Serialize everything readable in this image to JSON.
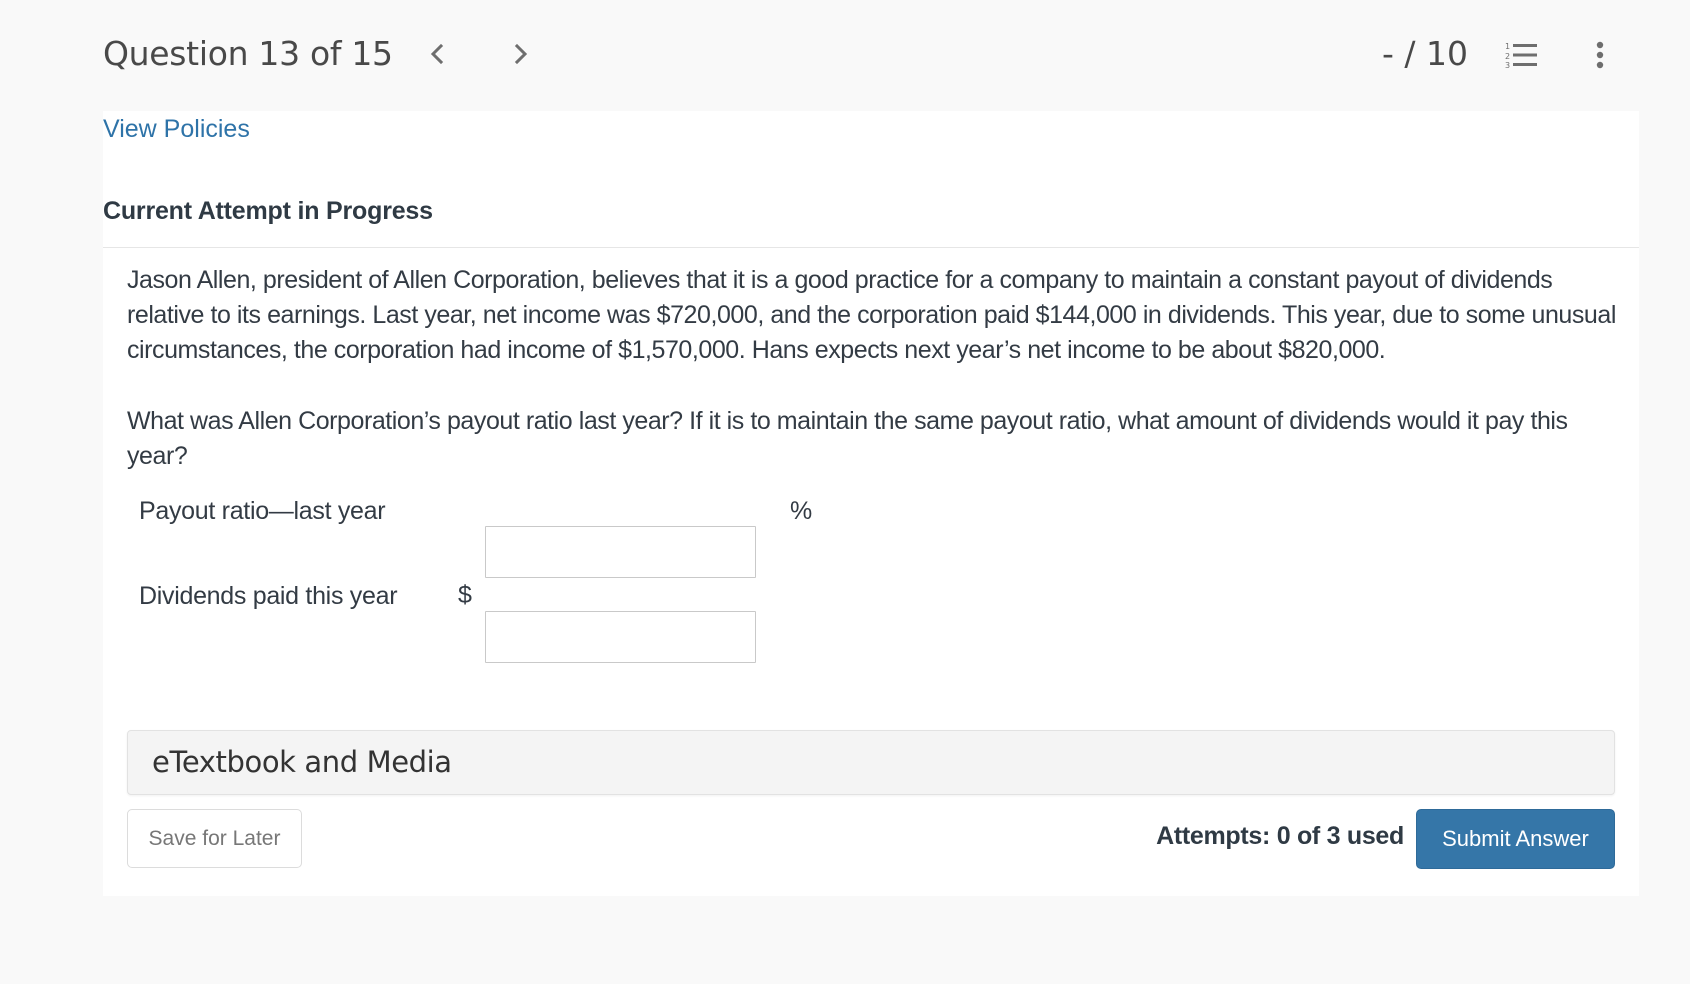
{
  "header": {
    "question_label": "Question 13 of 15",
    "score": "- / 10",
    "icons": {
      "prev": "chevron-left-icon",
      "next": "chevron-right-icon",
      "list": "numbered-list-icon",
      "menu": "kebab-menu-icon"
    }
  },
  "card": {
    "view_policies_link": "View Policies",
    "attempt_heading": "Current Attempt in Progress",
    "question_paragraphs": [
      "Jason Allen, president of Allen Corporation, believes that it is a good practice for a company to maintain a constant payout of dividends relative to its earnings. Last year, net income was $720,000, and the corporation paid $144,000 in dividends. This year, due to some unusual circumstances, the corporation had income of $1,570,000. Hans expects next year’s net income to be about $820,000.",
      "What was Allen Corporation’s payout ratio last year? If it is to maintain the same payout ratio, what amount of dividends would it pay this year?"
    ],
    "answer_rows": [
      {
        "label": "Payout ratio—last year",
        "prefix": "",
        "suffix": "%",
        "value": ""
      },
      {
        "label": "Dividends paid this year",
        "prefix": "$",
        "suffix": "",
        "value": ""
      }
    ],
    "etextbook_label": "eTextbook and Media",
    "save_label": "Save for Later",
    "attempts_text": "Attempts: 0 of 3 used",
    "submit_label": "Submit Answer"
  },
  "colors": {
    "link": "#2e73a8",
    "primary_button": "#3576a8",
    "page_background": "#f9f9f9",
    "card_background": "#ffffff"
  }
}
